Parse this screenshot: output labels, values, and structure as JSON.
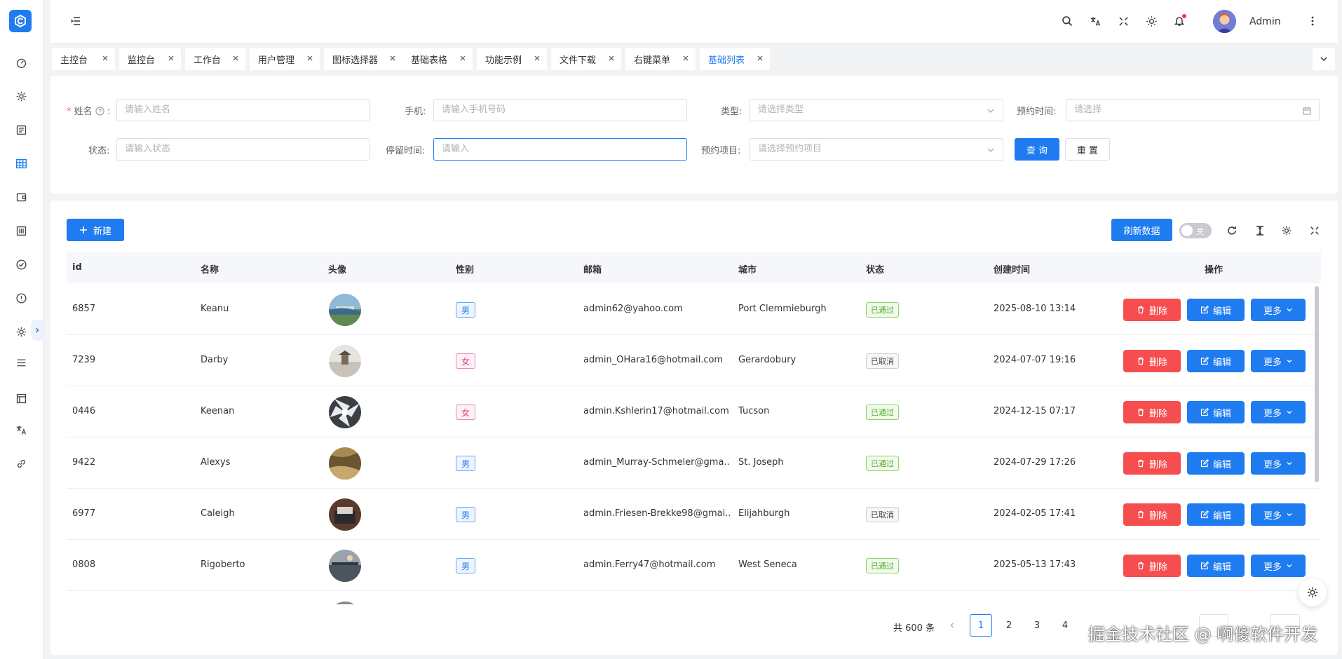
{
  "header": {
    "user_name": "Admin"
  },
  "tabs": [
    {
      "label": "主控台"
    },
    {
      "label": "监控台"
    },
    {
      "label": "工作台"
    },
    {
      "label": "用户管理"
    },
    {
      "label": "图标选择器"
    },
    {
      "label": "基础表格"
    },
    {
      "label": "功能示例"
    },
    {
      "label": "文件下载"
    },
    {
      "label": "右键菜单"
    },
    {
      "label": "基础列表",
      "active": true
    }
  ],
  "form": {
    "name": {
      "label": "姓名",
      "required_mark": "*",
      "colon": ":",
      "placeholder": "请输入姓名"
    },
    "phone": {
      "label": "手机:",
      "placeholder": "请输入手机号码"
    },
    "type": {
      "label": "类型:",
      "placeholder": "请选择类型"
    },
    "time": {
      "label": "预约时间:",
      "placeholder": "请选择"
    },
    "status": {
      "label": "状态:",
      "placeholder": "请输入状态"
    },
    "stay": {
      "label": "停留时间:",
      "placeholder": "请输入"
    },
    "project": {
      "label": "预约项目:",
      "placeholder": "请选择预约项目"
    },
    "query_label": "查 询",
    "reset_label": "重 置"
  },
  "toolbar": {
    "new_label": "新建",
    "refresh_label": "刷新数据",
    "toggle_label": "关"
  },
  "table": {
    "columns": [
      "id",
      "名称",
      "头像",
      "性别",
      "邮箱",
      "城市",
      "状态",
      "创建时间",
      "操作"
    ],
    "rows": [
      {
        "id": "6857",
        "name": "Keanu",
        "gender": "男",
        "email": "admin62@yahoo.com",
        "city": "Port Clemmieburgh",
        "status": "已通过",
        "created": "2025-08-10 13:14"
      },
      {
        "id": "7239",
        "name": "Darby",
        "gender": "女",
        "email": "admin_OHara16@hotmail.com",
        "city": "Gerardobury",
        "status": "已取消",
        "created": "2024-07-07 19:16"
      },
      {
        "id": "0446",
        "name": "Keenan",
        "gender": "女",
        "email": "admin.Kshlerin17@hotmail.com",
        "city": "Tucson",
        "status": "已通过",
        "created": "2024-12-15 07:17"
      },
      {
        "id": "9422",
        "name": "Alexys",
        "gender": "男",
        "email": "admin_Murray-Schmeler@gma...",
        "city": "St. Joseph",
        "status": "已通过",
        "created": "2024-07-29 17:26"
      },
      {
        "id": "6977",
        "name": "Caleigh",
        "gender": "男",
        "email": "admin.Friesen-Brekke98@gmai...",
        "city": "Elijahburgh",
        "status": "已取消",
        "created": "2024-02-05 17:41"
      },
      {
        "id": "0808",
        "name": "Rigoberto",
        "gender": "男",
        "email": "admin.Ferry47@hotmail.com",
        "city": "West Seneca",
        "status": "已通过",
        "created": "2025-05-13 17:43"
      }
    ],
    "actions": {
      "delete": "删除",
      "edit": "编辑",
      "more": "更多"
    }
  },
  "pagination": {
    "total": "共 600 条",
    "pages": [
      "1",
      "2",
      "3",
      "4"
    ],
    "current": "1"
  },
  "watermark": "掘金技术社区 @ 啊傻软件开发",
  "colors": {
    "primary": "#1f7cf0",
    "danger": "#f64e4f",
    "success": "#56b02a"
  }
}
